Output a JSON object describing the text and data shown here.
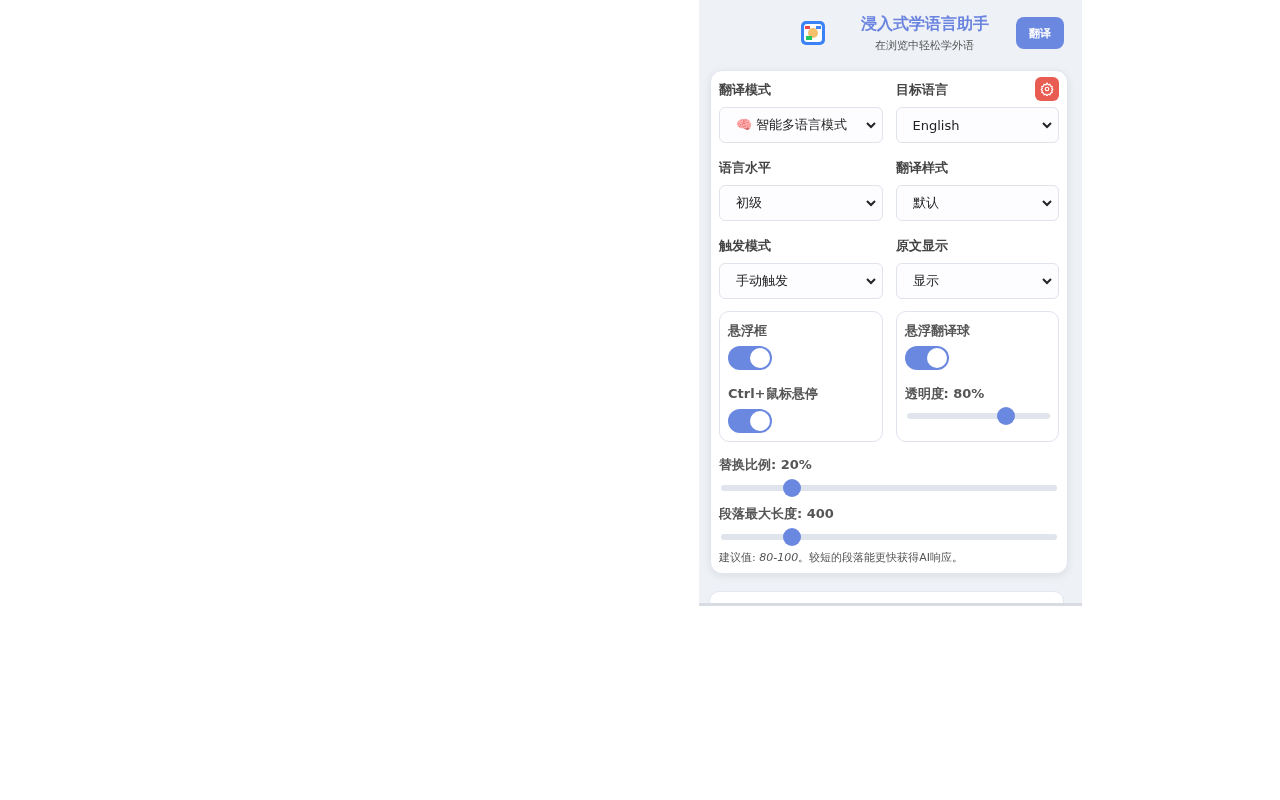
{
  "header": {
    "title": "浸入式学语言助手",
    "subtitle": "在浏览中轻松学外语",
    "translate_button": "翻译"
  },
  "settings": {
    "fields": [
      {
        "label": "翻译模式",
        "value": "智能多语言模式",
        "emoji": "🧠"
      },
      {
        "label": "目标语言",
        "value": "English"
      },
      {
        "label": "语言水平",
        "value": "初级"
      },
      {
        "label": "翻译样式",
        "value": "默认"
      },
      {
        "label": "触发模式",
        "value": "手动触发"
      },
      {
        "label": "原文显示",
        "value": "显示"
      }
    ],
    "panels": [
      {
        "items": [
          {
            "kind": "toggle",
            "label": "悬浮框",
            "checked": true
          },
          {
            "kind": "toggle",
            "label": "Ctrl+鼠标悬停",
            "checked": true
          }
        ]
      },
      {
        "items": [
          {
            "kind": "toggle",
            "label": "悬浮翻译球",
            "checked": true
          },
          {
            "kind": "slider",
            "label": "透明度: 80%",
            "level": 0.69
          }
        ]
      }
    ],
    "sliders": [
      {
        "label": "替换比例: 20%",
        "level": 0.21
      },
      {
        "label": "段落最大长度: 400",
        "level": 0.21
      }
    ],
    "hint": "建议值: *80-100*。较短的段落能更快获得AI响应。"
  }
}
